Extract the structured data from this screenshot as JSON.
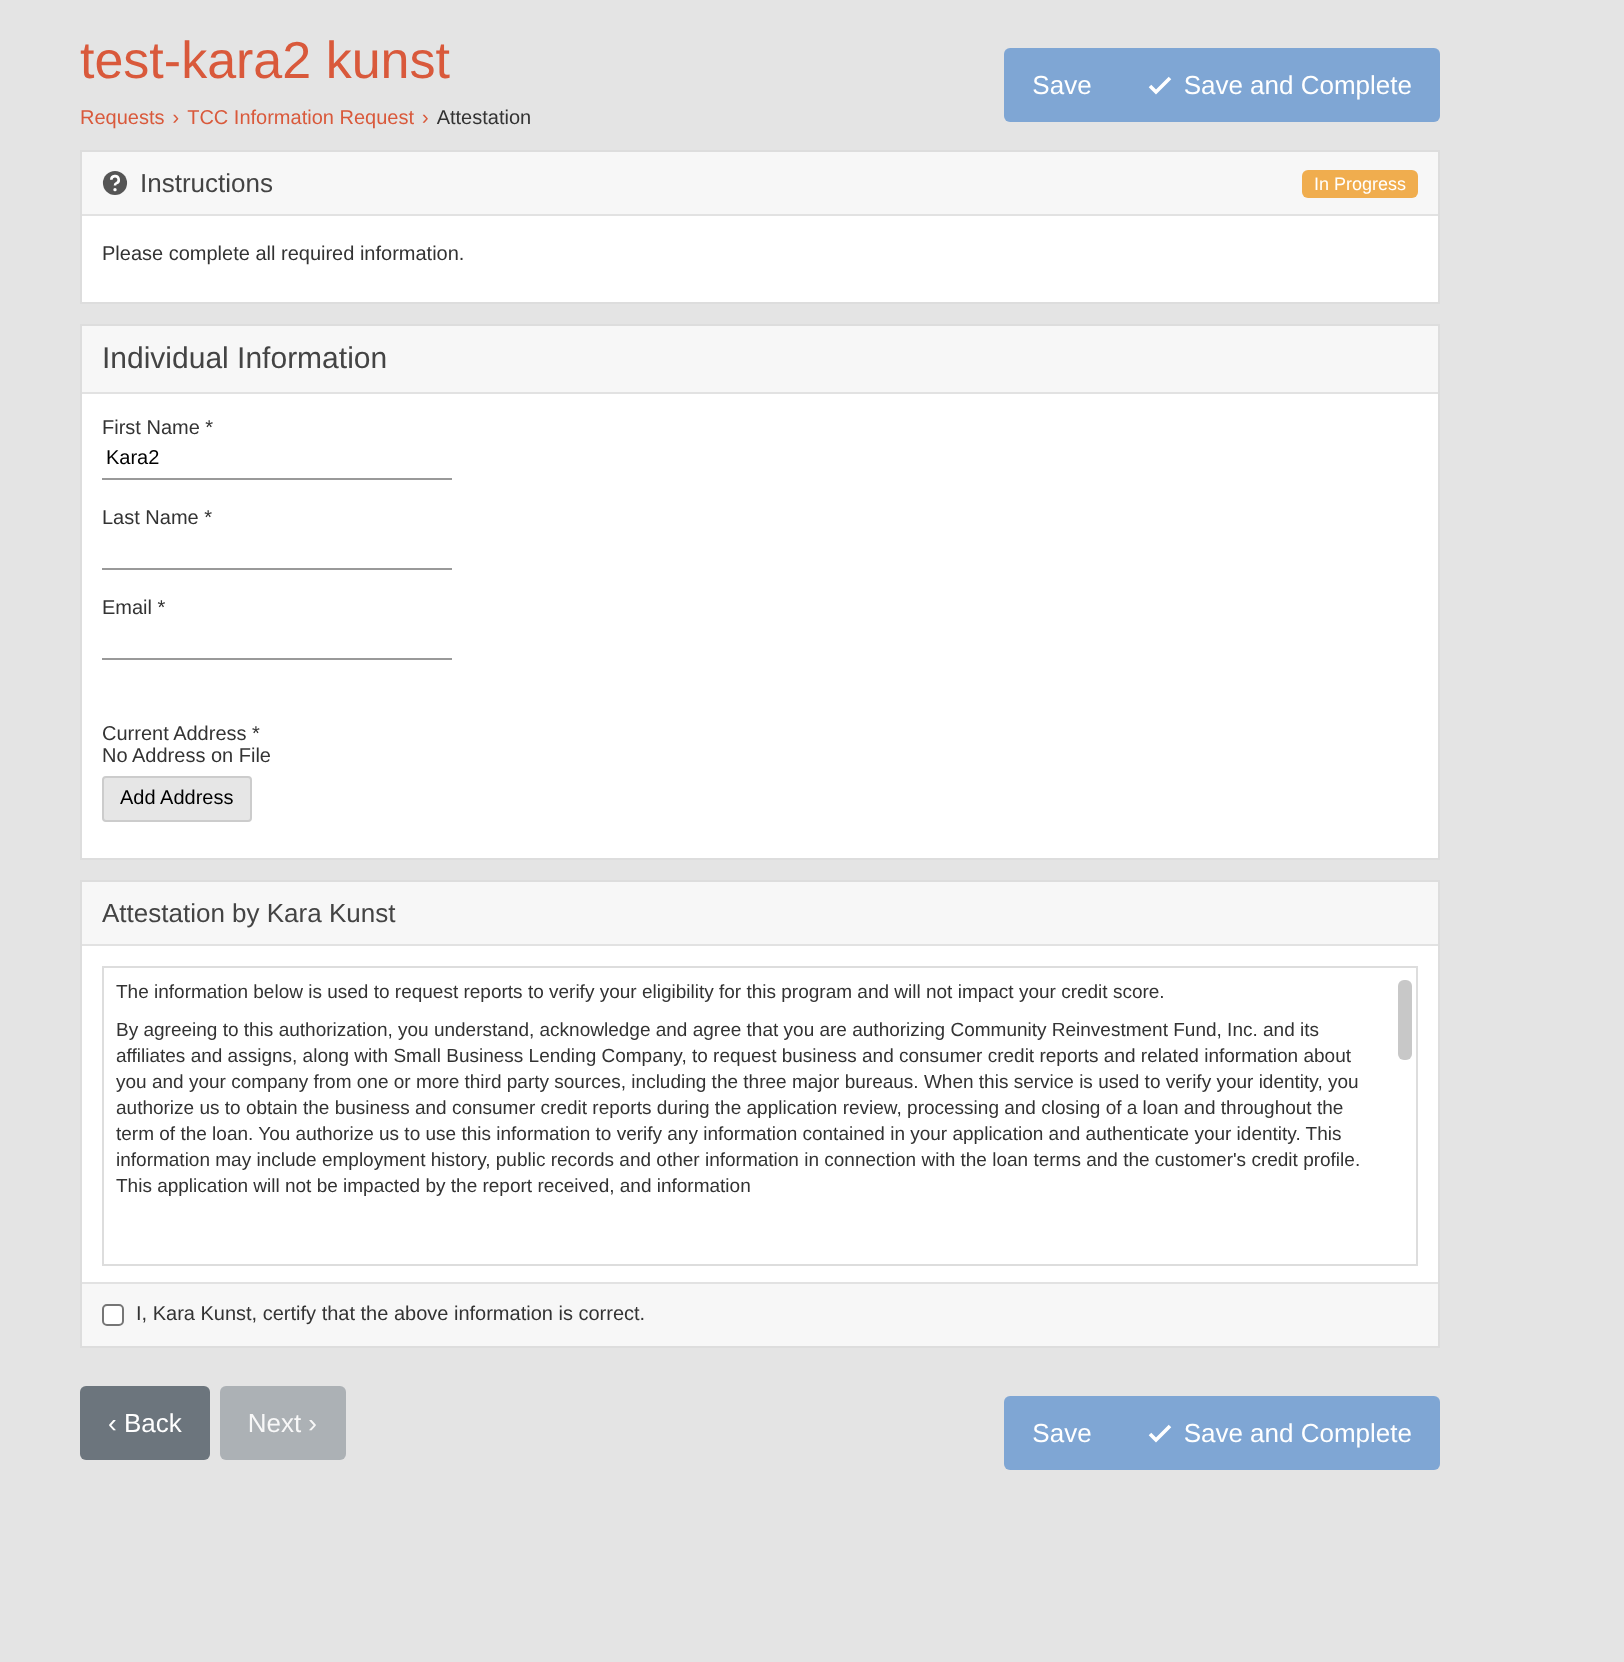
{
  "header": {
    "title": "test-kara2 kunst",
    "breadcrumb": [
      "Requests",
      "›",
      "TCC Information Request",
      "›"
    ],
    "current": "Attestation"
  },
  "top_actions": [
    {
      "label": "Save",
      "kind": "plain"
    },
    {
      "label": "Save and Complete",
      "kind": "complete"
    }
  ],
  "instructions": {
    "title": "Instructions",
    "badge": "In Progress",
    "text": "Please complete all required information."
  },
  "individual": {
    "title": "Individual Information",
    "fields": [
      {
        "label": "First Name *",
        "value": "Kara2"
      },
      {
        "label": "Last Name *"
      },
      {
        "label": "Email *"
      }
    ],
    "address": {
      "label": "Current Address *",
      "note": "No Address on File",
      "button": "Add Address"
    }
  },
  "attestation": {
    "title": "Attestation by Kara Kunst",
    "intro": "The information below is used to request reports to verify your eligibility for this program and will not impact your credit score.",
    "body": "By agreeing to this authorization, you understand, acknowledge and agree that you are authorizing Community Reinvestment Fund, Inc. and its affiliates and assigns, along with Small Business Lending Company, to request business and consumer credit reports and related information about you and your company from one or more third party sources, including the three major bureaus. When this service is used to verify your identity, you authorize us to obtain the business and consumer credit reports during the application review, processing and closing of a loan and throughout the term of the loan. You authorize us to use this information to verify any information contained in your application and authenticate your identity. This information may include employment history, public records and other information in connection with the loan terms and the customer's credit profile. This application will not be impacted by the report received, and information",
    "agree": {
      "label": "I, Kara Kunst, certify that the above information is correct.",
      "checked": false
    }
  },
  "footer": {
    "back": "‹ Back",
    "next": "Next ›",
    "next_disabled": true,
    "actions": [
      {
        "label": "Save",
        "kind": "plain"
      },
      {
        "label": "Save and Complete",
        "kind": "complete"
      }
    ]
  }
}
